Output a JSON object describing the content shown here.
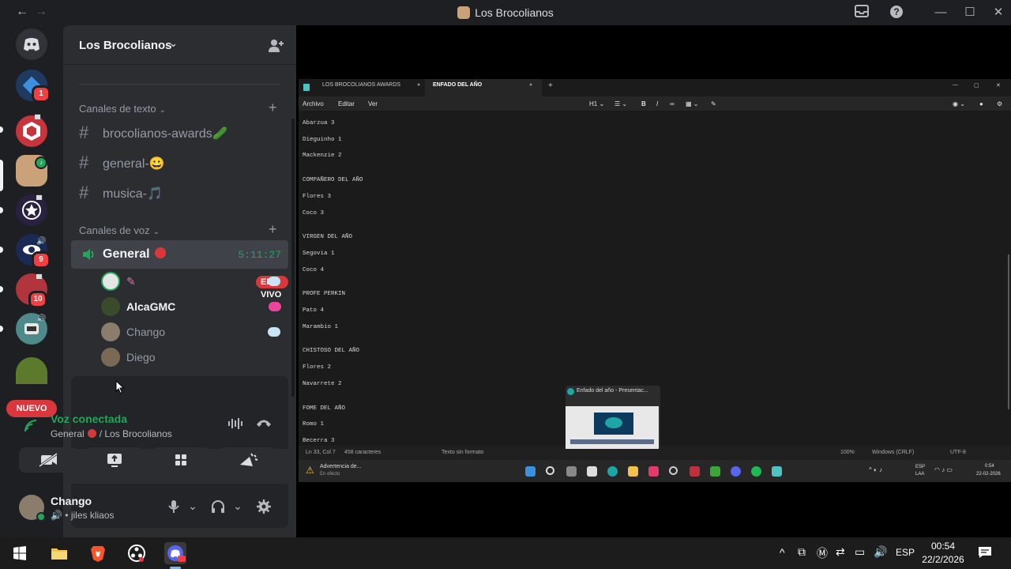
{
  "window": {
    "title": "Los Brocolianos",
    "back_icon": "←",
    "forward_icon": "→",
    "inbox_icon": "inbox-icon",
    "help_icon": "?"
  },
  "rail": {
    "badges": [
      "1",
      "9",
      "10"
    ],
    "nuevo_label": "NUEVO"
  },
  "server": {
    "name": "Los Brocolianos",
    "text_category": "Canales de texto",
    "voice_category": "Canales de voz",
    "text_channels": [
      {
        "label": "brocolianos-awards",
        "emoji": "🥒"
      },
      {
        "label": "general-",
        "emoji": "😀"
      },
      {
        "label": "musica-",
        "emoji": "🎵"
      }
    ],
    "voice_channel": {
      "label": "General",
      "timer": "5:11:27"
    },
    "voice_users": [
      {
        "name": "",
        "live": "EN VIVO"
      },
      {
        "name": "AlcaGMC"
      },
      {
        "name": "Chango"
      },
      {
        "name": "Diego"
      }
    ]
  },
  "voice_panel": {
    "title": "Voz conectada",
    "subtitle": "General",
    "subtitle_suffix": "/ Los Brocolianos"
  },
  "user_panel": {
    "name": "Chango",
    "status": "jiles kliaos"
  },
  "notepad": {
    "tabs": [
      "LOS BROCOLIANOS AWARDS",
      "ENFADO DEL AÑO"
    ],
    "menu": [
      "Archivo",
      "Editar",
      "Ver"
    ],
    "lines": [
      "Abarzua 3",
      "Dieguinho 1",
      "Mackenzie 2",
      "",
      "COMPAÑERO DEL AÑO",
      "Flores 3",
      "Coco 3",
      "",
      "VIRGEN DEL AÑO",
      "Segovia 1",
      "Coco 4",
      "",
      "PROFE PERKIN",
      "Pato 4",
      "Marambio 1",
      "",
      "CHISTOSO DEL AÑO",
      "Flores 2",
      "Navarrete 2",
      "",
      "FOME DEL AÑO",
      "Romo 1",
      "Becerra 3"
    ],
    "status": {
      "position": "Ln 33, Col 7",
      "chars": "458 caracteres",
      "format": "Texto sin formato",
      "zoom": "100%",
      "eol": "Windows (CRLF)",
      "encoding": "UTF-8"
    },
    "taskbar_warning": "Advertencia de...",
    "taskbar_warning_sub": "En efecto",
    "preview_title": "Enfado del año - Presentac...",
    "lang": "ESP",
    "lang_sub": "LAA",
    "time": "0:54",
    "date": "22-02-2026"
  },
  "taskbar": {
    "lang": "ESP",
    "time": "00:54",
    "date": "22/2/2026"
  }
}
